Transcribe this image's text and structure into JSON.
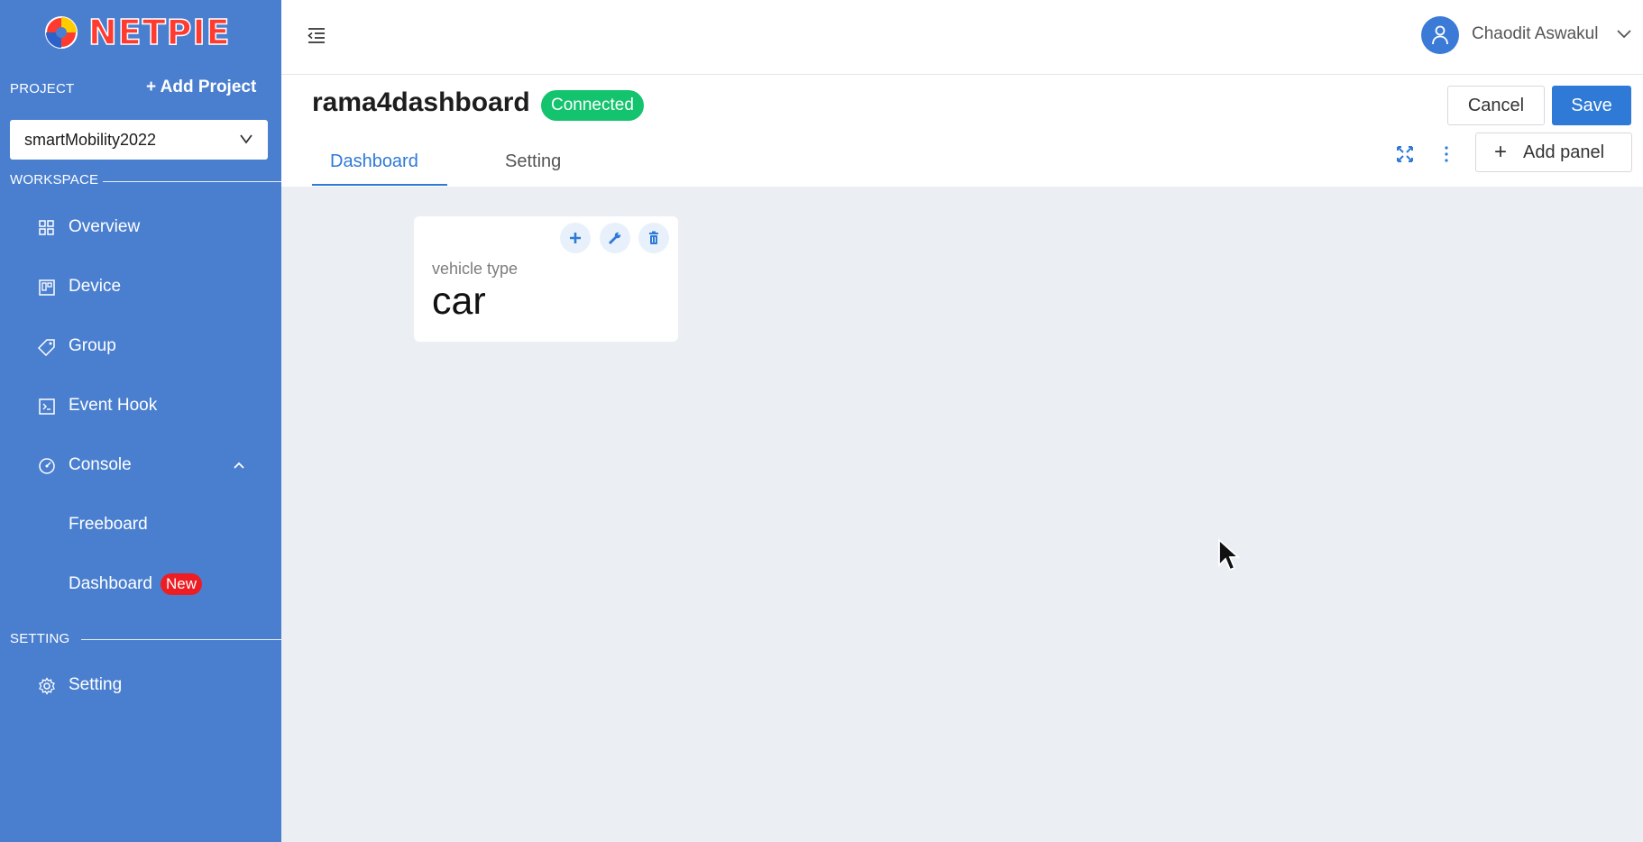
{
  "app": {
    "logo_text": "NETPIE",
    "brand_color": "#4a7fd0",
    "accent": "#2e7ad6"
  },
  "sidebar": {
    "project_label": "PROJECT",
    "add_project": "+ Add Project",
    "project_selected": "smartMobility2022",
    "workspace_label": "WORKSPACE",
    "items": [
      {
        "label": "Overview",
        "icon": "grid-icon"
      },
      {
        "label": "Device",
        "icon": "device-icon"
      },
      {
        "label": "Group",
        "icon": "tag-icon"
      },
      {
        "label": "Event Hook",
        "icon": "terminal-icon"
      },
      {
        "label": "Console",
        "icon": "gauge-icon"
      }
    ],
    "console_children": [
      {
        "label": "Freeboard"
      },
      {
        "label": "Dashboard",
        "badge": "New"
      }
    ],
    "setting_label": "SETTING",
    "setting_item": "Setting"
  },
  "topbar": {
    "user_name": "Chaodit Aswakul"
  },
  "header": {
    "title": "rama4dashboard",
    "status": "Connected",
    "status_color": "#14c36e",
    "cancel_label": "Cancel",
    "save_label": "Save",
    "tabs": [
      {
        "label": "Dashboard",
        "active": true
      },
      {
        "label": "Setting",
        "active": false
      }
    ],
    "add_panel_label": "Add panel"
  },
  "panel": {
    "label": "vehicle type",
    "value": "car"
  }
}
